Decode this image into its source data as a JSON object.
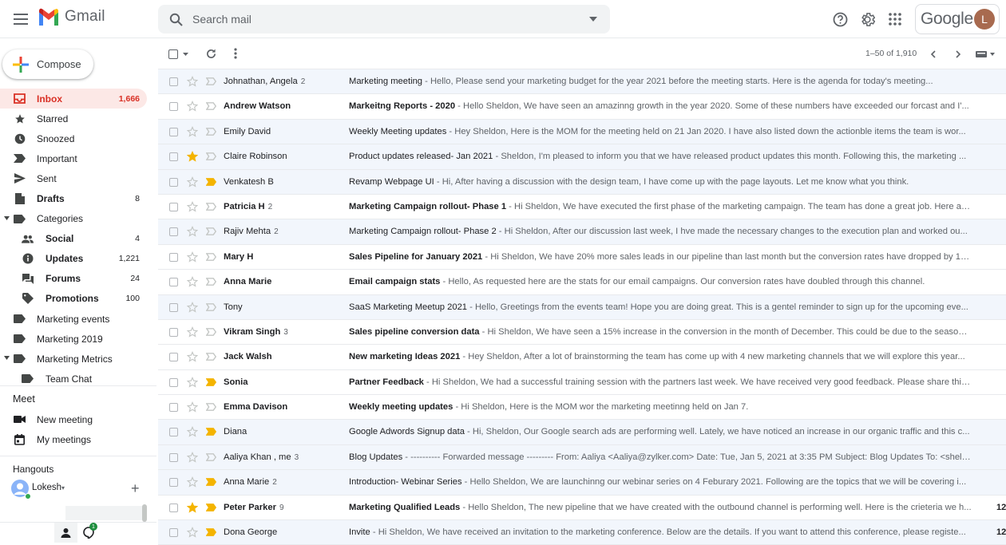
{
  "brand": {
    "name": "Gmail",
    "google": "Google",
    "avatar_initial": "L"
  },
  "search": {
    "placeholder": "Search mail"
  },
  "compose": {
    "label": "Compose"
  },
  "nav": [
    {
      "id": "inbox",
      "label": "Inbox",
      "count": "1,666",
      "icon": "inbox-icon",
      "active": true,
      "bold": true
    },
    {
      "id": "starred",
      "label": "Starred",
      "count": "",
      "icon": "star-icon"
    },
    {
      "id": "snoozed",
      "label": "Snoozed",
      "count": "",
      "icon": "clock-icon"
    },
    {
      "id": "important",
      "label": "Important",
      "count": "",
      "icon": "important-icon"
    },
    {
      "id": "sent",
      "label": "Sent",
      "count": "",
      "icon": "send-icon"
    },
    {
      "id": "drafts",
      "label": "Drafts",
      "count": "8",
      "icon": "draft-icon",
      "bold": true
    },
    {
      "id": "categories",
      "label": "Categories",
      "count": "",
      "icon": "label-icon",
      "caret": true
    },
    {
      "id": "social",
      "label": "Social",
      "count": "4",
      "icon": "people-icon",
      "sub": true,
      "bold": true
    },
    {
      "id": "updates",
      "label": "Updates",
      "count": "1,221",
      "icon": "info-icon",
      "sub": true,
      "bold": true
    },
    {
      "id": "forums",
      "label": "Forums",
      "count": "24",
      "icon": "forum-icon",
      "sub": true,
      "bold": true
    },
    {
      "id": "promotions",
      "label": "Promotions",
      "count": "100",
      "icon": "tag-icon",
      "sub": true,
      "bold": true
    },
    {
      "id": "marketing-events",
      "label": "Marketing events",
      "count": "",
      "icon": "label-icon"
    },
    {
      "id": "marketing-2019",
      "label": "Marketing 2019",
      "count": "",
      "icon": "label-icon"
    },
    {
      "id": "marketing-metrics",
      "label": "Marketing Metrics",
      "count": "",
      "icon": "label-icon",
      "caret": true
    },
    {
      "id": "team-chat",
      "label": "Team Chat",
      "count": "",
      "icon": "label-icon",
      "sub": true
    }
  ],
  "meet": {
    "title": "Meet",
    "new_meeting": "New meeting",
    "my_meetings": "My meetings"
  },
  "hangouts": {
    "title": "Hangouts",
    "user": "Lokesh",
    "badge": "1"
  },
  "toolbar": {
    "pager": "1–50 of 1,910"
  },
  "emails": [
    {
      "sender": "Johnathan, Angela",
      "count": "2",
      "subject": "Marketing meeting",
      "snippet": " - Hello, Please send your marketing budget for the year 2021 before the meeting starts. Here is the agenda for today's meeting...",
      "unread": false,
      "starred": false,
      "important": false
    },
    {
      "sender": "Andrew Watson",
      "count": "",
      "subject": "Markeitng Reports - 2020",
      "snippet": " - Hello Sheldon, We have seen an amazinng growth in the year 2020. Some of these numbers have exceeded our forcast and I'...",
      "unread": true,
      "starred": false,
      "important": false
    },
    {
      "sender": "Emily David",
      "count": "",
      "subject": "Weekly Meeting updates",
      "snippet": " - Hey Sheldon, Here is the MOM for the meeting held on 21 Jan 2020. I have also listed down the actionble items the team is wor...",
      "unread": false,
      "starred": false,
      "important": false
    },
    {
      "sender": "Claire Robinson",
      "count": "",
      "subject": "Product updates released- Jan 2021",
      "snippet": " - Sheldon, I'm pleased to inform you that we have released product updates this month. Following this, the marketing ...",
      "unread": false,
      "starred": true,
      "important": false
    },
    {
      "sender": "Venkatesh B",
      "count": "",
      "subject": "Revamp Webpage UI",
      "snippet": " - Hi, After having a discussion with the design team, I have come up with the page layouts. Let me know what you think.",
      "unread": false,
      "starred": false,
      "important": true
    },
    {
      "sender": "Patricia H",
      "count": "2",
      "subject": "Marketing Campaign rollout- Phase 1",
      "snippet": " - Hi Sheldon, We have executed the first phase of the marketing campaign. The team has done a great job. Here are...",
      "unread": true,
      "starred": false,
      "important": false
    },
    {
      "sender": "Rajiv Mehta",
      "count": "2",
      "subject": "Marketing Campaign rollout- Phase 2",
      "snippet": " - Hi Sheldon, After our discussion last week, I hve made the necessary changes to the execution plan and worked ou...",
      "unread": false,
      "starred": false,
      "important": false
    },
    {
      "sender": "Mary H",
      "count": "",
      "subject": "Sales Pipeline for January 2021",
      "snippet": " - Hi Sheldon, We have 20% more sales leads in our pipeline than last month but the conversion rates have dropped by 10 ...",
      "unread": true,
      "starred": false,
      "important": false
    },
    {
      "sender": "Anna Marie",
      "count": "",
      "subject": "Email campaign stats",
      "snippet": " - Hello, As requested here are the stats for our email campaigns. Our conversion rates have doubled through this channel.",
      "unread": true,
      "starred": false,
      "important": false
    },
    {
      "sender": "Tony",
      "count": "",
      "subject": "SaaS Marketing Meetup 2021",
      "snippet": " - Hello, Greetings from the events team! Hope you are doing great. This is a gentel reminder to sign up for the upcoming eve...",
      "unread": false,
      "starred": false,
      "important": false
    },
    {
      "sender": "Vikram Singh",
      "count": "3",
      "subject": "Sales pipeline conversion data",
      "snippet": " - Hi Sheldon, We have seen a 15% increase in the conversion in the month of December. This could be due to the seasonal ...",
      "unread": true,
      "starred": false,
      "important": false
    },
    {
      "sender": "Jack Walsh",
      "count": "",
      "subject": "New marketing Ideas 2021",
      "snippet": " - Hey Sheldon, After a lot of brainstorming the team has come up with 4 new marketing channels that we will explore this year...",
      "unread": true,
      "starred": false,
      "important": false
    },
    {
      "sender": "Sonia",
      "count": "",
      "subject": "Partner Feedback",
      "snippet": " - Hi Sheldon, We had a successful training session with the partners last week. We have received very good feedback. Please share this...",
      "unread": true,
      "starred": false,
      "important": true
    },
    {
      "sender": "Emma Davison",
      "count": "",
      "subject": "Weekly meeting updates",
      "snippet": " - Hi Sheldon, Here is the MOM wor the marketing meetinng held on Jan 7.",
      "unread": true,
      "starred": false,
      "important": false
    },
    {
      "sender": "Diana",
      "count": "",
      "subject": "Google Adwords Signup data",
      "snippet": " - Hi, Sheldon, Our Google search ads are performing well. Lately, we have noticed an increase in our organic traffic and this c...",
      "unread": false,
      "starred": false,
      "important": true
    },
    {
      "sender": "Aaliya Khan , me",
      "count": "3",
      "subject": "Blog Updates",
      "snippet": " - ---------- Forwarded message --------- From: Aaliya <Aaliya@zylker.com> Date: Tue, Jan 5, 2021 at 3:35 PM Subject: Blog Updates To: <sheldon...",
      "unread": false,
      "starred": false,
      "important": false
    },
    {
      "sender": "Anna Marie",
      "count": "2",
      "subject": "Introduction- Webinar Series",
      "snippet": " - Hello Sheldon, We are launchinng our webinar series on 4 Feburary 2021. Following are the topics that we will be covering i...",
      "unread": false,
      "starred": false,
      "important": true
    },
    {
      "sender": "Peter Parker",
      "count": "9",
      "subject": "Marketing Qualified Leads",
      "snippet": " - Hello Sheldon, The new pipeline that we have created with the outbound channel is performing well. Here is the crieteria we h...",
      "unread": true,
      "starred": true,
      "important": true,
      "date": "12"
    },
    {
      "sender": "Dona George",
      "count": "",
      "subject": "Invite",
      "snippet": " - Hi Sheldon, We have received an invitation to the marketing conference. Below are the details. If you want to attend this conference, please registe...",
      "unread": false,
      "starred": false,
      "important": true,
      "date": "12"
    }
  ],
  "colors": {
    "accent": "#d93025",
    "star": "#f4b400",
    "important": "#f4b400",
    "read_row": "#f2f6fc",
    "hover_nav": "#fce8e6"
  }
}
